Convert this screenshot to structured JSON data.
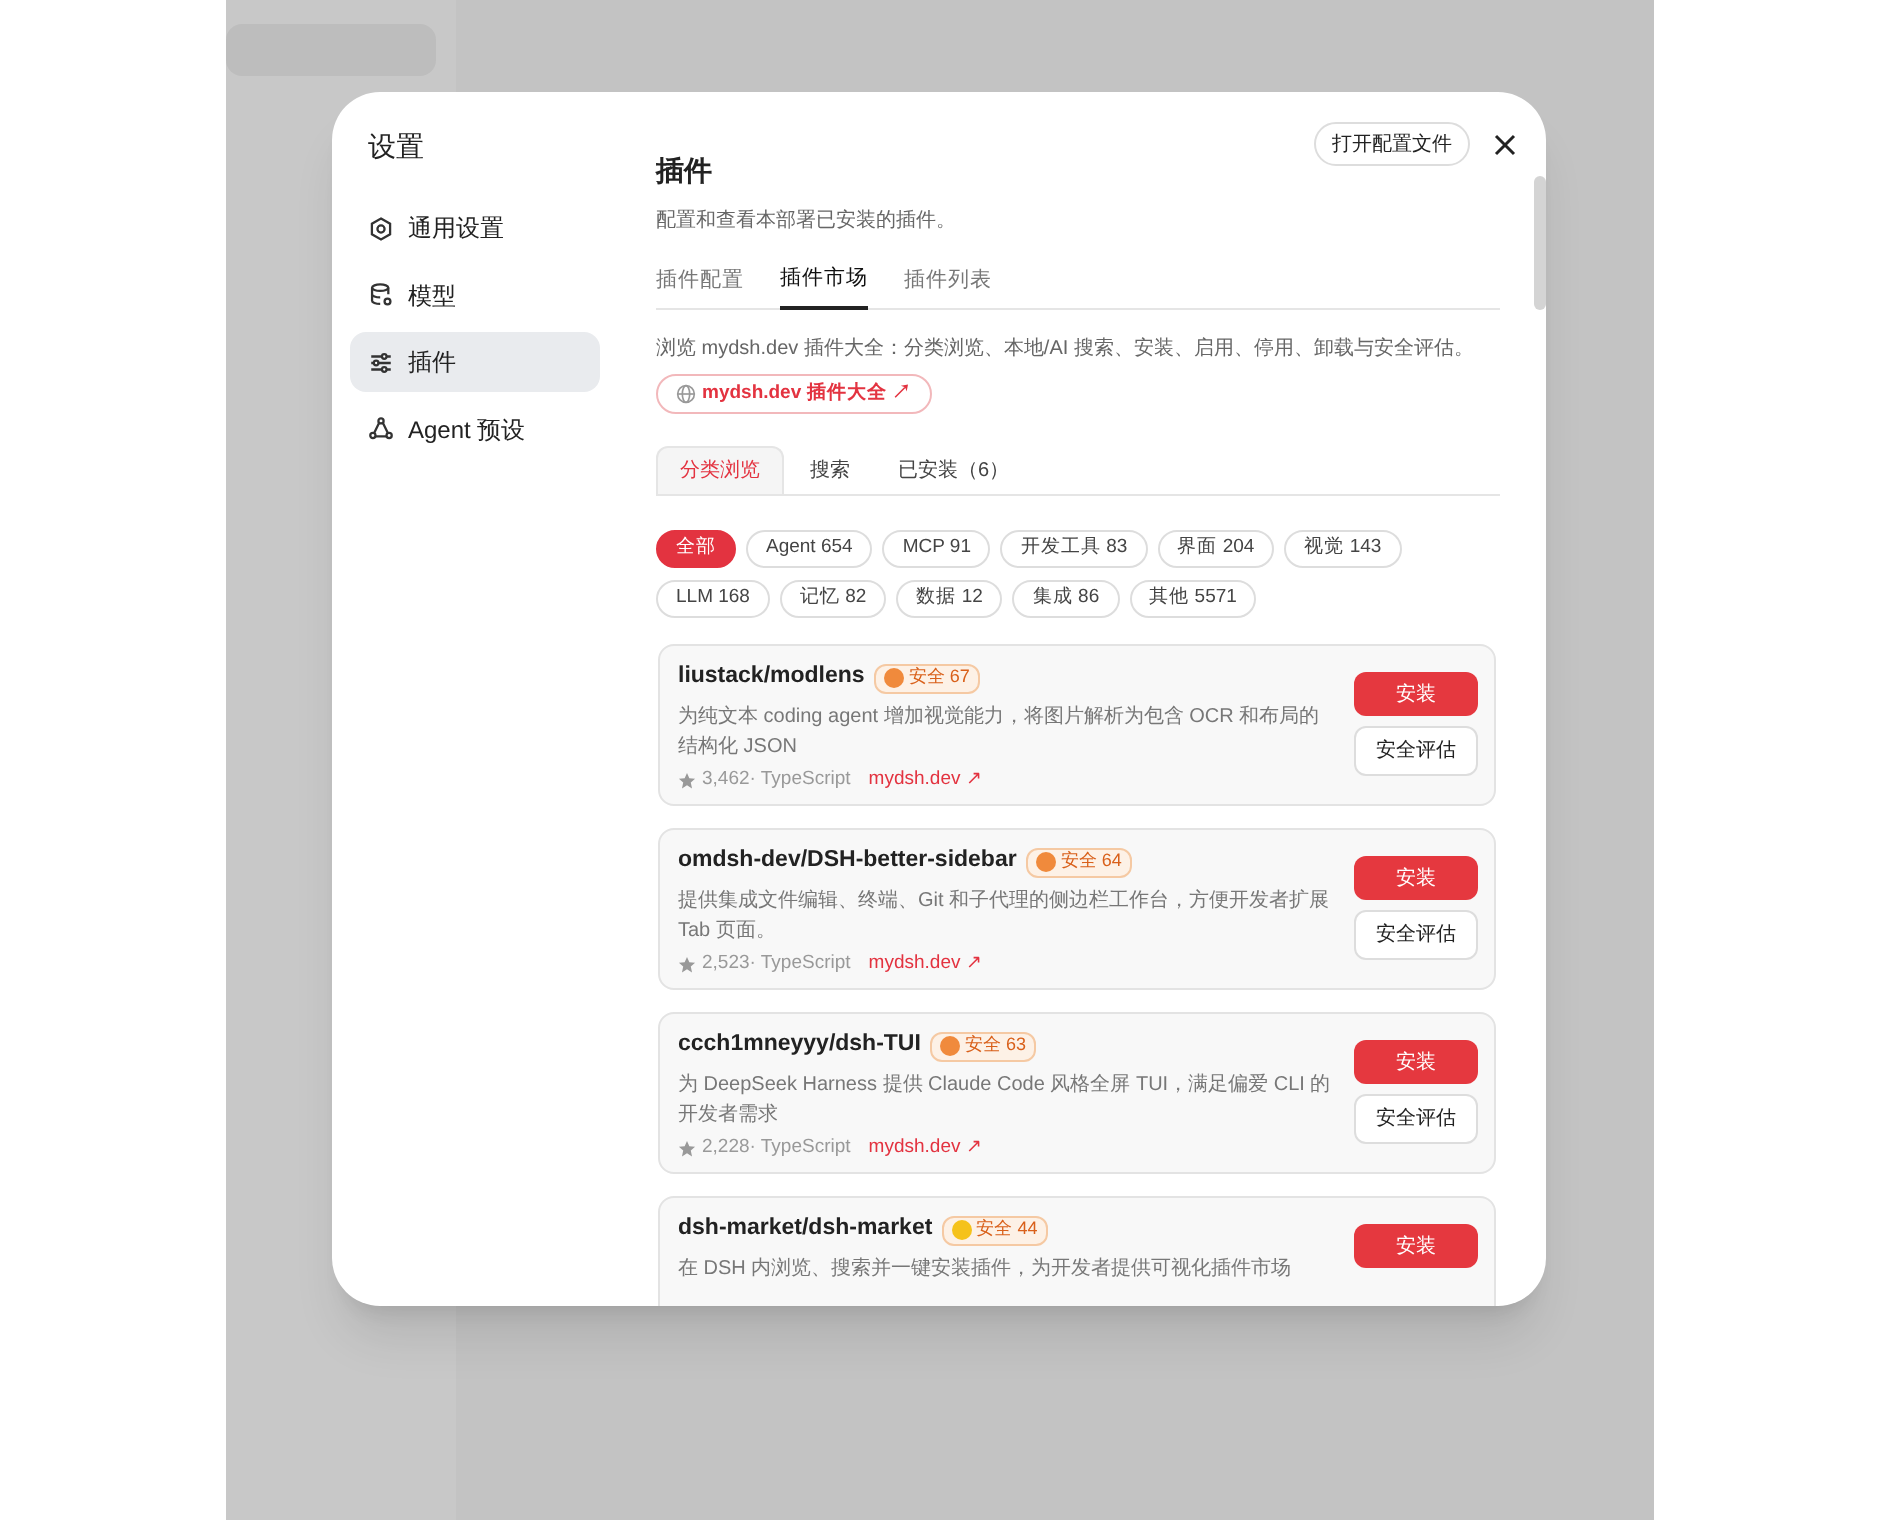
{
  "sidebar": {
    "title": "设置",
    "items": [
      {
        "label": "通用设置",
        "selected": false
      },
      {
        "label": "模型",
        "selected": false
      },
      {
        "label": "插件",
        "selected": true
      },
      {
        "label": "Agent 预设",
        "selected": false
      }
    ]
  },
  "header": {
    "open_config_button": "打开配置文件"
  },
  "panel": {
    "title": "插件",
    "subtitle": "配置和查看本部署已安装的插件。",
    "tabs": [
      {
        "label": "插件配置",
        "selected": false
      },
      {
        "label": "插件市场",
        "selected": true
      },
      {
        "label": "插件列表",
        "selected": false
      }
    ],
    "description": "浏览 mydsh.dev 插件大全：分类浏览、本地/AI 搜索、安装、启用、停用、卸载与安全评估。",
    "site_link": "mydsh.dev 插件大全 ↗",
    "subtabs": [
      {
        "label": "分类浏览",
        "selected": true
      },
      {
        "label": "搜索",
        "selected": false
      },
      {
        "label": "已安装（6）",
        "selected": false
      }
    ],
    "categories": [
      {
        "label": "全部",
        "selected": true
      },
      {
        "label": "Agent 654",
        "selected": false
      },
      {
        "label": "MCP 91",
        "selected": false
      },
      {
        "label": "开发工具 83",
        "selected": false
      },
      {
        "label": "界面 204",
        "selected": false
      },
      {
        "label": "视觉 143",
        "selected": false
      },
      {
        "label": "LLM 168",
        "selected": false
      },
      {
        "label": "记忆 82",
        "selected": false
      },
      {
        "label": "数据 12",
        "selected": false
      },
      {
        "label": "集成 86",
        "selected": false
      },
      {
        "label": "其他 5571",
        "selected": false
      }
    ],
    "plugins": [
      {
        "name": "liustack/modlens",
        "badge": "安全 67",
        "color": "#f08a3c",
        "description": "为纯文本 coding agent 增加视觉能力，将图片解析为包含 OCR 和布局的结构化 JSON",
        "meta": "3,462· TypeScript",
        "link": "mydsh.dev ↗",
        "install": "安装",
        "evaluate": "安全评估"
      },
      {
        "name": "omdsh-dev/DSH-better-sidebar",
        "badge": "安全 64",
        "color": "#f08a3c",
        "description": "提供集成文件编辑、终端、Git 和子代理的侧边栏工作台，方便开发者扩展 Tab 页面。",
        "meta": "2,523· TypeScript",
        "link": "mydsh.dev ↗",
        "install": "安装",
        "evaluate": "安全评估"
      },
      {
        "name": "ccch1mneyyy/dsh-TUI",
        "badge": "安全 63",
        "color": "#f08a3c",
        "description": "为 DeepSeek Harness 提供 Claude Code 风格全屏 TUI，满足偏爱 CLI 的开发者需求",
        "meta": "2,228· TypeScript",
        "link": "mydsh.dev ↗",
        "install": "安装",
        "evaluate": "安全评估"
      },
      {
        "name": "dsh-market/dsh-market",
        "badge": "安全 44",
        "color": "#f5c21b",
        "description": "在 DSH 内浏览、搜索并一键安装插件，为开发者提供可视化插件市场",
        "install": "安装"
      }
    ]
  }
}
